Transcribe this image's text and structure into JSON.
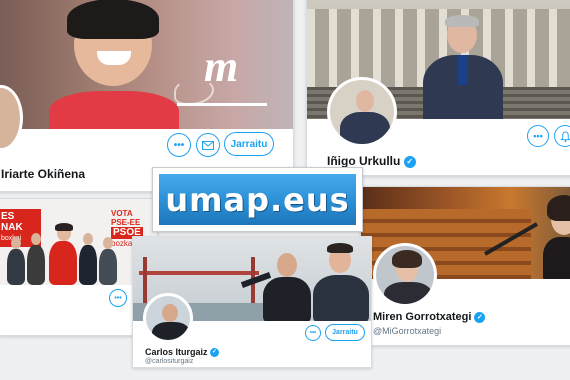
{
  "profiles": [
    {
      "name": "Idoia Mendia Iriarte Okiñena",
      "display_name": "Iriarte Okiñena",
      "logo_text": "m",
      "follow_label": "Jarraitu"
    },
    {
      "name": "Iñigo Urkullu",
      "verified": true
    },
    {
      "name": "Miren Gorrotxategi",
      "handle": "@MiGorrotxategi",
      "verified": true
    },
    {
      "name": "Carlos Iturgaiz",
      "handle": "@carlositurgaiz",
      "verified": true,
      "follow_label": "Jarraitu"
    }
  ],
  "socialist_banner": {
    "left_text_1": "ES",
    "left_text_2": "NAK",
    "left_text_3": "boxkai",
    "vote_line_1": "VOTA",
    "vote_line_2": "PSE-EE",
    "vote_line_3": "PSOE",
    "vote_line_4": "bozkatu"
  },
  "umap_logo": {
    "text": "umap.eus"
  },
  "icons": {
    "more": "more-icon",
    "message": "envelope-icon",
    "notify": "bell-icon",
    "verified": "verified-badge-icon"
  },
  "colors": {
    "twitter_blue": "#1da1f2",
    "pse_red": "#d9261c",
    "umap_blue": "#2a8fd6",
    "parliament_orange": "#c9782e"
  }
}
